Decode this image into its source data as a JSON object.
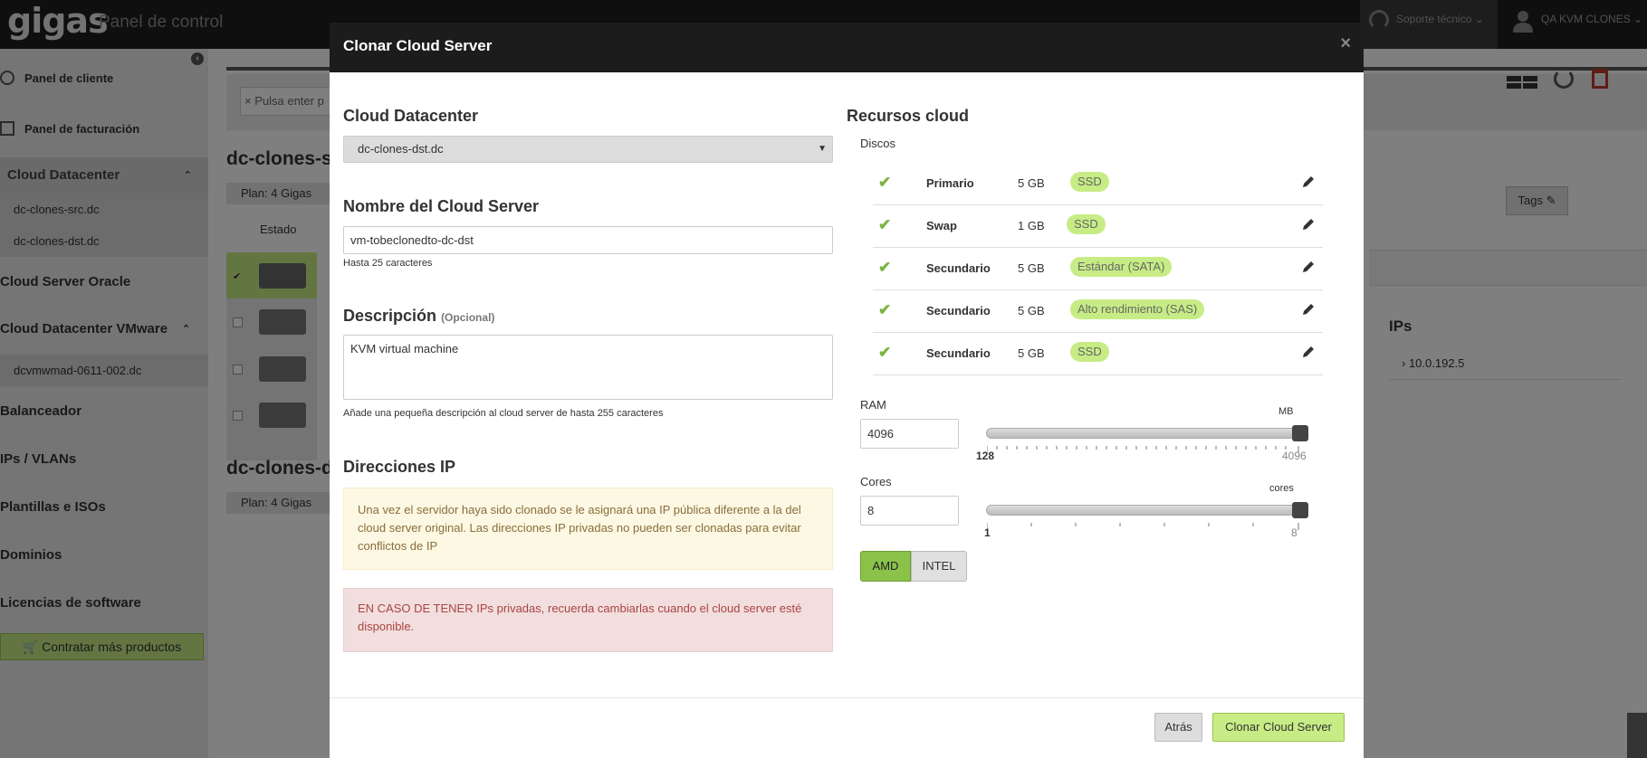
{
  "topbar": {
    "logo": "gigas",
    "title": "Panel de control",
    "support_label": "Soporte técnico",
    "user_label": "QA KVM CLONES"
  },
  "sidebar": {
    "items": [
      {
        "label": "Panel de cliente"
      },
      {
        "label": "Panel de facturación"
      },
      {
        "label": "Cloud Datacenter"
      },
      {
        "label": "dc-clones-src.dc"
      },
      {
        "label": "dc-clones-dst.dc"
      },
      {
        "label": "Cloud Server Oracle"
      },
      {
        "label": "Cloud Datacenter VMware"
      },
      {
        "label": "dcvmwmad-0611-002.dc"
      },
      {
        "label": "Balanceador"
      },
      {
        "label": "IPs / VLANs"
      },
      {
        "label": "Plantillas e ISOs"
      },
      {
        "label": "Dominios"
      },
      {
        "label": "Licencias de software"
      }
    ],
    "buy_button": "Contratar más productos"
  },
  "background": {
    "search_placeholder": "Pulsa enter p",
    "section1_title": "dc-clones-s",
    "section2_title": "dc-clones-d",
    "plan_label": "Plan:",
    "plan_value": "4 Gigas",
    "status_header": "Estado",
    "toggle_off": "off",
    "toggle_on": "on",
    "tags_button": "Tags",
    "ips_title": "IPs",
    "ip_value": "10.0.192.5"
  },
  "modal": {
    "title": "Clonar Cloud Server",
    "close": "×",
    "datacenter": {
      "heading": "Cloud Datacenter",
      "selected": "dc-clones-dst.dc"
    },
    "server_name": {
      "heading": "Nombre del Cloud Server",
      "value": "vm-tobeclonedto-dc-dst",
      "help": "Hasta 25 caracteres"
    },
    "description": {
      "heading": "Descripción",
      "optional": "(Opcional)",
      "value": "KVM virtual machine",
      "help": "Añade una pequeña descripción al cloud server de hasta 255 caracteres"
    },
    "ip": {
      "heading": "Direcciones IP",
      "warning": "Una vez el servidor haya sido clonado se le asignará una IP pública diferente a la del cloud server original. Las direcciones IP privadas no pueden ser clonadas para evitar conflictos de IP",
      "danger": "EN CASO DE TENER IPs privadas, recuerda cambiarlas cuando el cloud server esté disponible."
    },
    "resources": {
      "heading": "Recursos cloud",
      "disks_label": "Discos",
      "disks": [
        {
          "name": "Primario",
          "size": "5 GB",
          "type": "SSD"
        },
        {
          "name": "Swap",
          "size": "1 GB",
          "type": "SSD"
        },
        {
          "name": "Secundario",
          "size": "5 GB",
          "type": "Estándar (SATA)"
        },
        {
          "name": "Secundario",
          "size": "5 GB",
          "type": "Alto rendimiento (SAS)"
        },
        {
          "name": "Secundario",
          "size": "5 GB",
          "type": "SSD"
        }
      ],
      "ram": {
        "label": "RAM",
        "value": "4096",
        "unit": "MB",
        "min": "128",
        "max": "4096",
        "level": 1.0
      },
      "cores": {
        "label": "Cores",
        "value": "8",
        "unit": "cores",
        "min": "1",
        "max": "8",
        "level": 1.0
      },
      "cpu_amd": "AMD",
      "cpu_intel": "INTEL"
    },
    "back_button": "Atrás",
    "clone_button": "Clonar Cloud Server"
  },
  "colors": {
    "accent_green": "#8bc34a",
    "light_green": "#c7ec85",
    "topbar": "#1f1f1f"
  }
}
